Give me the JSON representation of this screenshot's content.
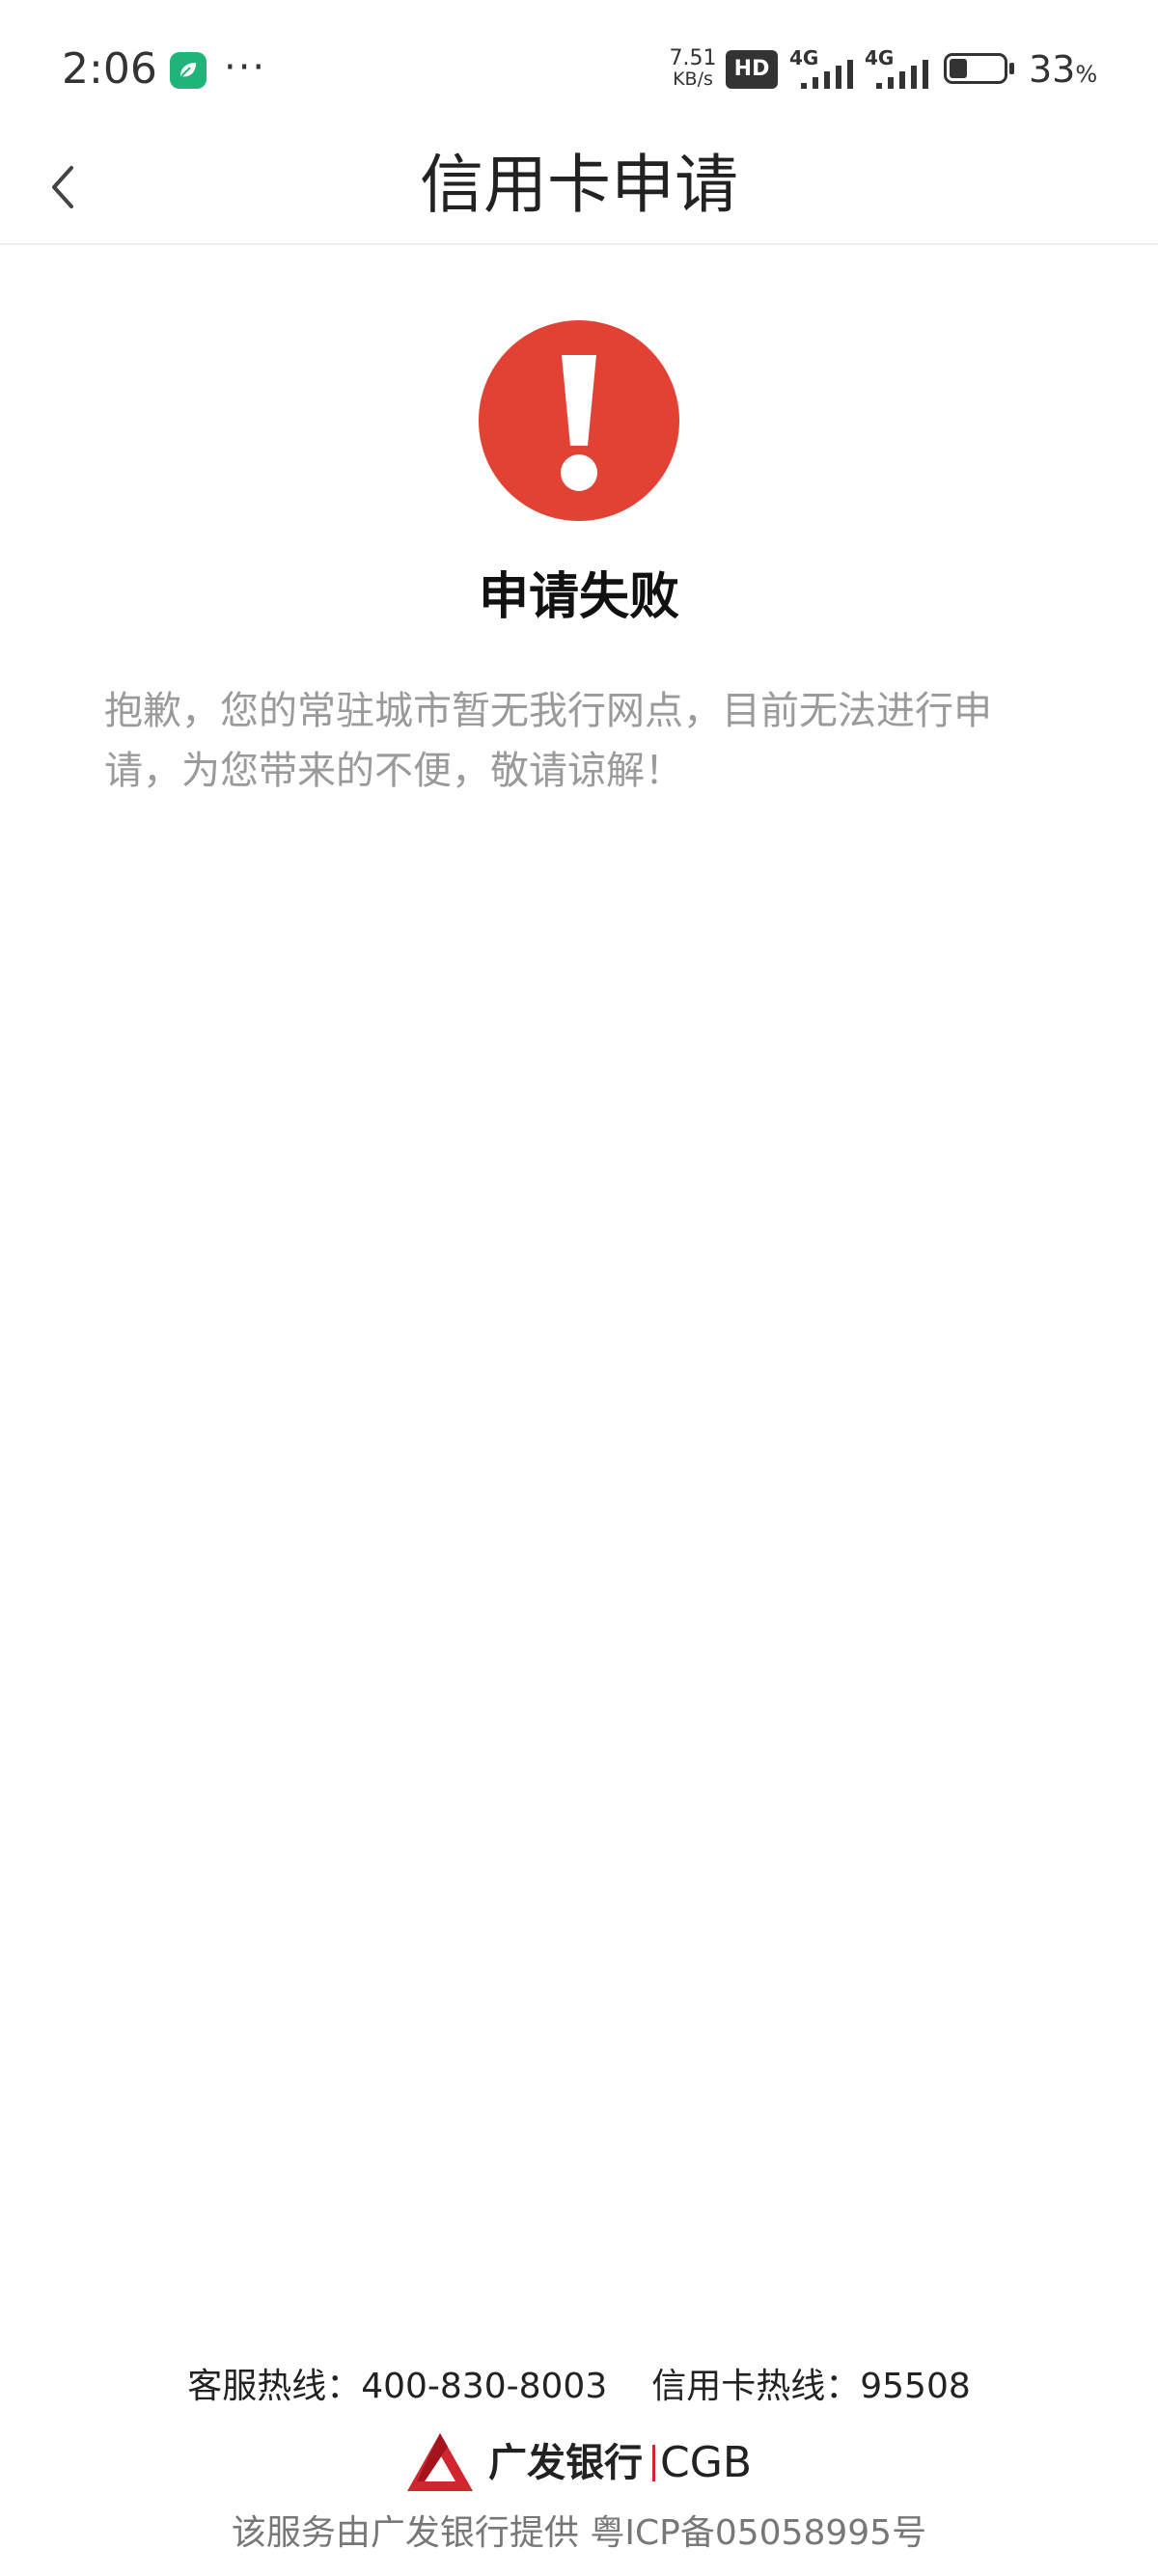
{
  "status_bar": {
    "time": "2:06",
    "net_speed_value": "7.51",
    "net_speed_unit": "KB/s",
    "hd_label": "HD",
    "sim1_network": "4G",
    "sim2_network": "4G",
    "battery_percent": "33",
    "battery_unit": "%",
    "battery_level": 0.33,
    "app_badge_color": "#1fb47a"
  },
  "nav": {
    "title": "信用卡申请",
    "back_icon": "chevron-left-icon"
  },
  "result": {
    "icon": "exclamation-circle-icon",
    "icon_color": "#e24234",
    "title": "申请失败",
    "message": "抱歉，您的常驻城市暂无我行网点，目前无法进行申请，为您带来的不便，敬请谅解！"
  },
  "footer": {
    "service_hotline": "客服热线：400-830-8003",
    "card_hotline": "信用卡热线：95508",
    "bank_name_cn": "广发银行",
    "bank_name_en": "CGB",
    "brand_color": "#d2262f",
    "note": "该服务由广发银行提供 粤ICP备05058995号"
  }
}
